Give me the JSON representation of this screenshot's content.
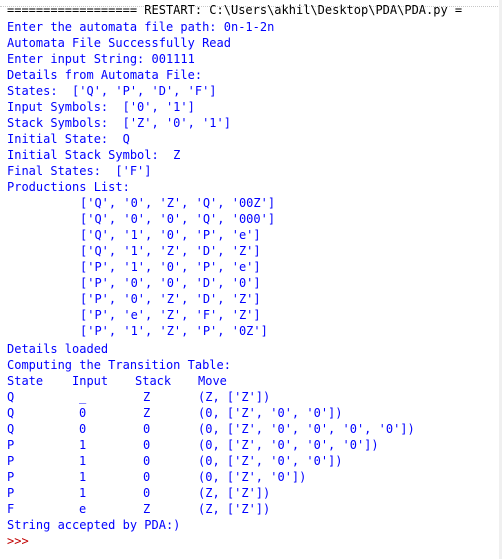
{
  "console": {
    "restart": "================== RESTART: C:\\Users\\akhil\\Desktop\\PDA\\PDA.py =",
    "output": [
      "Enter the automata file path: 0n-1-2n",
      "Automata File Successfully Read",
      "Enter input String: 001111",
      "Details from Automata File:",
      "States:  ['Q', 'P', 'D', 'F']",
      "Input Symbols:  ['0', '1']",
      "Stack Symbols:  ['Z', '0', '1']",
      "Initial State:  Q",
      "Initial Stack Symbol:  Z",
      "Final States:  ['F']",
      "Productions List:"
    ],
    "productions": [
      "['Q', '0', 'Z', 'Q', '00Z']",
      "['Q', '0', '0', 'Q', '000']",
      "['Q', '1', '0', 'P', 'e']",
      "['Q', '1', 'Z', 'D', 'Z']",
      "['P', '1', '0', 'P', 'e']",
      "['P', '0', '0', 'D', '0']",
      "['P', '0', 'Z', 'D', 'Z']",
      "['P', 'e', 'Z', 'F', 'Z']",
      "['P', '1', 'Z', 'P', '0Z']"
    ],
    "details_loaded": "Details loaded",
    "computing": "Computing the Transition Table:",
    "table": {
      "headers": {
        "state": "State",
        "input": "Input",
        "stack": "Stack",
        "move": "Move"
      },
      "rows": [
        {
          "state": "Q",
          "input": "_",
          "stack": "Z",
          "move": "(Z, ['Z'])"
        },
        {
          "state": "Q",
          "input": "0",
          "stack": "Z",
          "move": "(0, ['Z', '0', '0'])"
        },
        {
          "state": "Q",
          "input": "0",
          "stack": "0",
          "move": "(0, ['Z', '0', '0', '0', '0'])"
        },
        {
          "state": "P",
          "input": "1",
          "stack": "0",
          "move": "(0, ['Z', '0', '0', '0'])"
        },
        {
          "state": "P",
          "input": "1",
          "stack": "0",
          "move": "(0, ['Z', '0', '0'])"
        },
        {
          "state": "P",
          "input": "1",
          "stack": "0",
          "move": "(0, ['Z', '0'])"
        },
        {
          "state": "P",
          "input": "1",
          "stack": "0",
          "move": "(Z, ['Z'])"
        },
        {
          "state": "F",
          "input": "e",
          "stack": "Z",
          "move": "(Z, ['Z'])"
        }
      ]
    },
    "result": "String accepted by PDA:)",
    "prompt": ">>>"
  },
  "colors": {
    "output_text": "#0000ff",
    "shell_text": "#000000",
    "prompt": "#c00000",
    "background": "#ffffff"
  }
}
